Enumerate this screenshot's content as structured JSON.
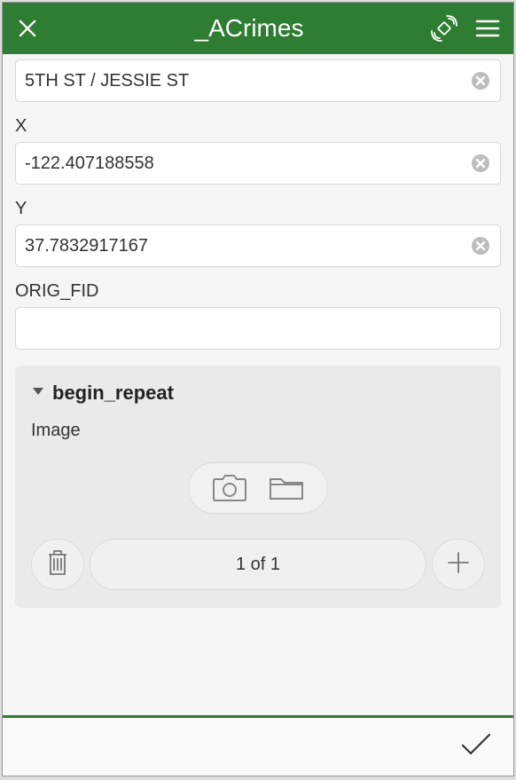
{
  "header": {
    "title": "_ACrimes"
  },
  "fields": {
    "address": {
      "value": "5TH ST / JESSIE ST"
    },
    "x": {
      "label": "X",
      "value": "-122.407188558"
    },
    "y": {
      "label": "Y",
      "value": "37.7832917167"
    },
    "orig_fid": {
      "label": "ORIG_FID",
      "value": ""
    }
  },
  "repeat": {
    "title": "begin_repeat",
    "sublabel": "Image",
    "pager": "1 of 1"
  },
  "colors": {
    "accent": "#2e7d32"
  }
}
